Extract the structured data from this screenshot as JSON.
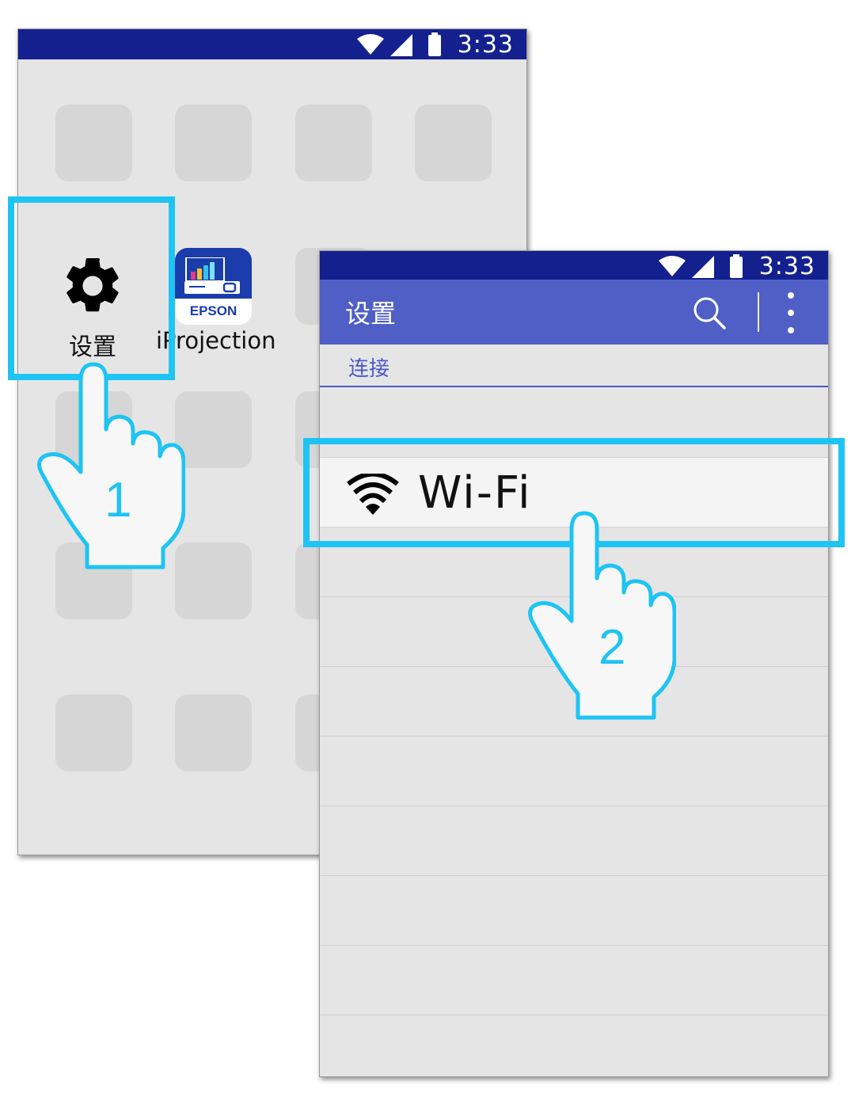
{
  "status_bar": {
    "time": "3:33"
  },
  "home_screen": {
    "apps": [
      {
        "label": "设置",
        "icon": "gear-icon"
      },
      {
        "label": "iProjection",
        "icon": "epson-iprojection-icon",
        "brand_text": "EPSON"
      }
    ]
  },
  "settings_screen": {
    "title": "设置",
    "section": "连接",
    "wifi_label": "Wi-Fi",
    "toolbar_icons": [
      "search-icon",
      "more-vert-icon"
    ]
  },
  "steps": [
    {
      "number": "1"
    },
    {
      "number": "2"
    }
  ],
  "colors": {
    "status_bar": "#13208e",
    "toolbar": "#4f5fc6",
    "highlight": "#1ec4f3",
    "screen_bg": "#e5e5e5",
    "tile": "#d6d6d6"
  }
}
